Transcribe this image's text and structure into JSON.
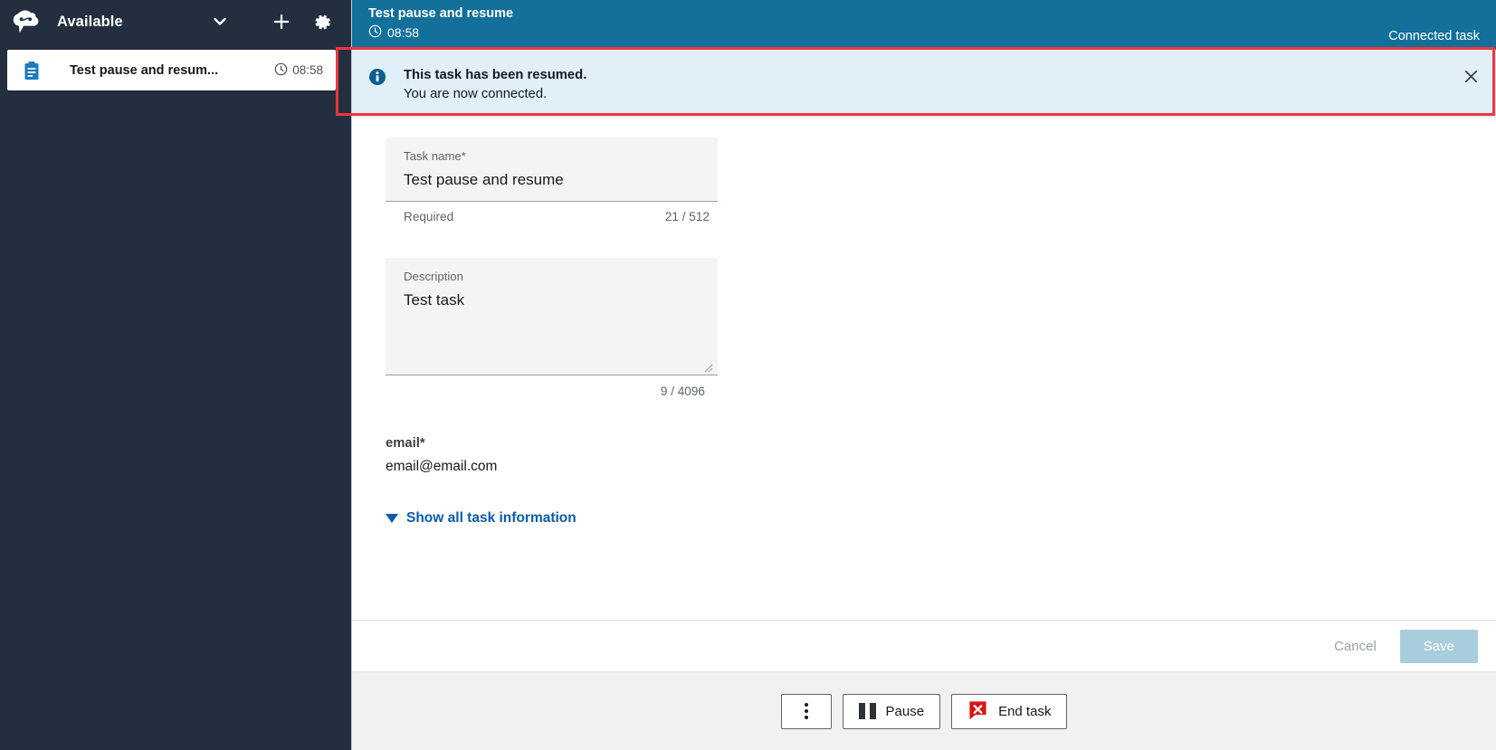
{
  "sidebar": {
    "logo_icon": "cloud-contact-logo",
    "status": "Available",
    "chevron_icon": "chevron-down-icon",
    "add_icon": "plus-icon",
    "settings_icon": "gear-icon",
    "task_card": {
      "icon": "clipboard-task-icon",
      "title": "Test pause and resum...",
      "clock_icon": "clock-icon",
      "time": "08:58"
    },
    "bg_color": "#232f3e"
  },
  "header": {
    "title": "Test pause and resume",
    "clock_icon": "clock-icon",
    "timer": "08:58",
    "connection_status": "Connected task",
    "bg_color": "#12709a"
  },
  "banner": {
    "icon": "info-circle-icon",
    "title": "This task has been resumed.",
    "subtitle": "You are now connected.",
    "close_icon": "close-icon",
    "bg_color": "#e1f0f8",
    "highlight_color": "#f5333f"
  },
  "form": {
    "task_name": {
      "label": "Task name*",
      "value": "Test pause and resume",
      "helper": "Required",
      "counter": "21 / 512"
    },
    "description": {
      "label": "Description",
      "value": "Test task",
      "counter": "9 / 4096",
      "resize_handle_icon": "resize-grip-icon"
    },
    "email": {
      "label": "email*",
      "value": "email@email.com"
    },
    "show_all": {
      "caret_icon": "caret-down-icon",
      "label": "Show all task information",
      "color": "#0b5bab"
    }
  },
  "save_bar": {
    "cancel_label": "Cancel",
    "save_label": "Save",
    "save_disabled_color": "#a8cede"
  },
  "controls": {
    "more_icon": "kebab-menu-icon",
    "pause_icon": "pause-icon",
    "pause_label": "Pause",
    "end_icon": "end-task-icon",
    "end_label": "End task",
    "end_icon_color": "#d91515"
  }
}
